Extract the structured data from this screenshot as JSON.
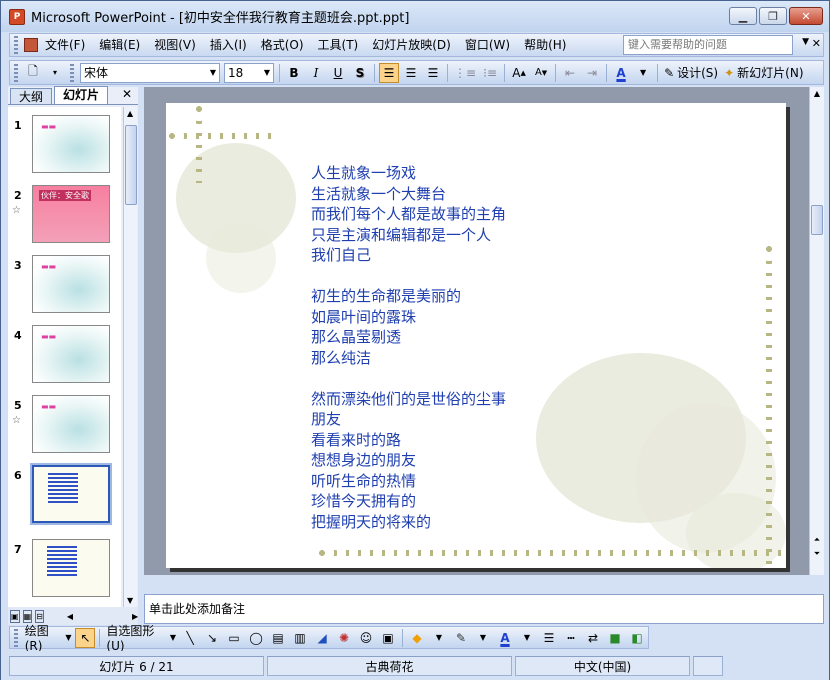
{
  "window": {
    "title": "Microsoft PowerPoint - [初中安全伴我行教育主题班会.ppt.ppt]",
    "app_icon_label": "P"
  },
  "menubar": {
    "items": [
      "文件(F)",
      "编辑(E)",
      "视图(V)",
      "插入(I)",
      "格式(O)",
      "工具(T)",
      "幻灯片放映(D)",
      "窗口(W)",
      "帮助(H)"
    ],
    "help_placeholder": "键入需要帮助的问题"
  },
  "toolbar": {
    "font_name": "宋体",
    "font_size": "18",
    "bold": "B",
    "italic": "I",
    "underline": "U",
    "shadow": "S",
    "design_label": "设计(S)",
    "new_slide_label": "新幻灯片(N)"
  },
  "leftpane": {
    "tabs": [
      "大纲",
      "幻灯片"
    ],
    "active_tab": "幻灯片",
    "thumbnails": [
      {
        "num": "1",
        "style": "lotus",
        "star": false
      },
      {
        "num": "2",
        "style": "pink",
        "label": "伙伴：安全歌",
        "star": true
      },
      {
        "num": "3",
        "style": "lotus",
        "star": false
      },
      {
        "num": "4",
        "style": "lotus",
        "star": false
      },
      {
        "num": "5",
        "style": "lotus",
        "star": true
      },
      {
        "num": "6",
        "style": "pale",
        "star": false,
        "selected": true
      },
      {
        "num": "7",
        "style": "pale",
        "star": false
      }
    ]
  },
  "slide": {
    "lines": [
      "人生就象一场戏",
      "生活就象一个大舞台",
      "而我们每个人都是故事的主角",
      "只是主演和编辑都是一个人",
      "我们自己",
      "",
      "初生的生命都是美丽的",
      "如晨叶间的露珠",
      "那么晶莹剔透",
      "那么纯洁",
      "",
      "然而漂染他们的是世俗的尘事",
      "朋友",
      "看看来时的路",
      "想想身边的朋友",
      "听听生命的热情",
      "珍惜今天拥有的",
      "把握明天的将来的"
    ]
  },
  "notes": {
    "placeholder": "单击此处添加备注"
  },
  "drawbar": {
    "draw_label": "绘图(R)",
    "autoshapes_label": "自选图形(U)"
  },
  "status": {
    "slide_position": "幻灯片 6 / 21",
    "design_template": "古典荷花",
    "language": "中文(中国)"
  },
  "colors": {
    "text_blue": "#1f3fb0",
    "vine": "#b7b784"
  }
}
